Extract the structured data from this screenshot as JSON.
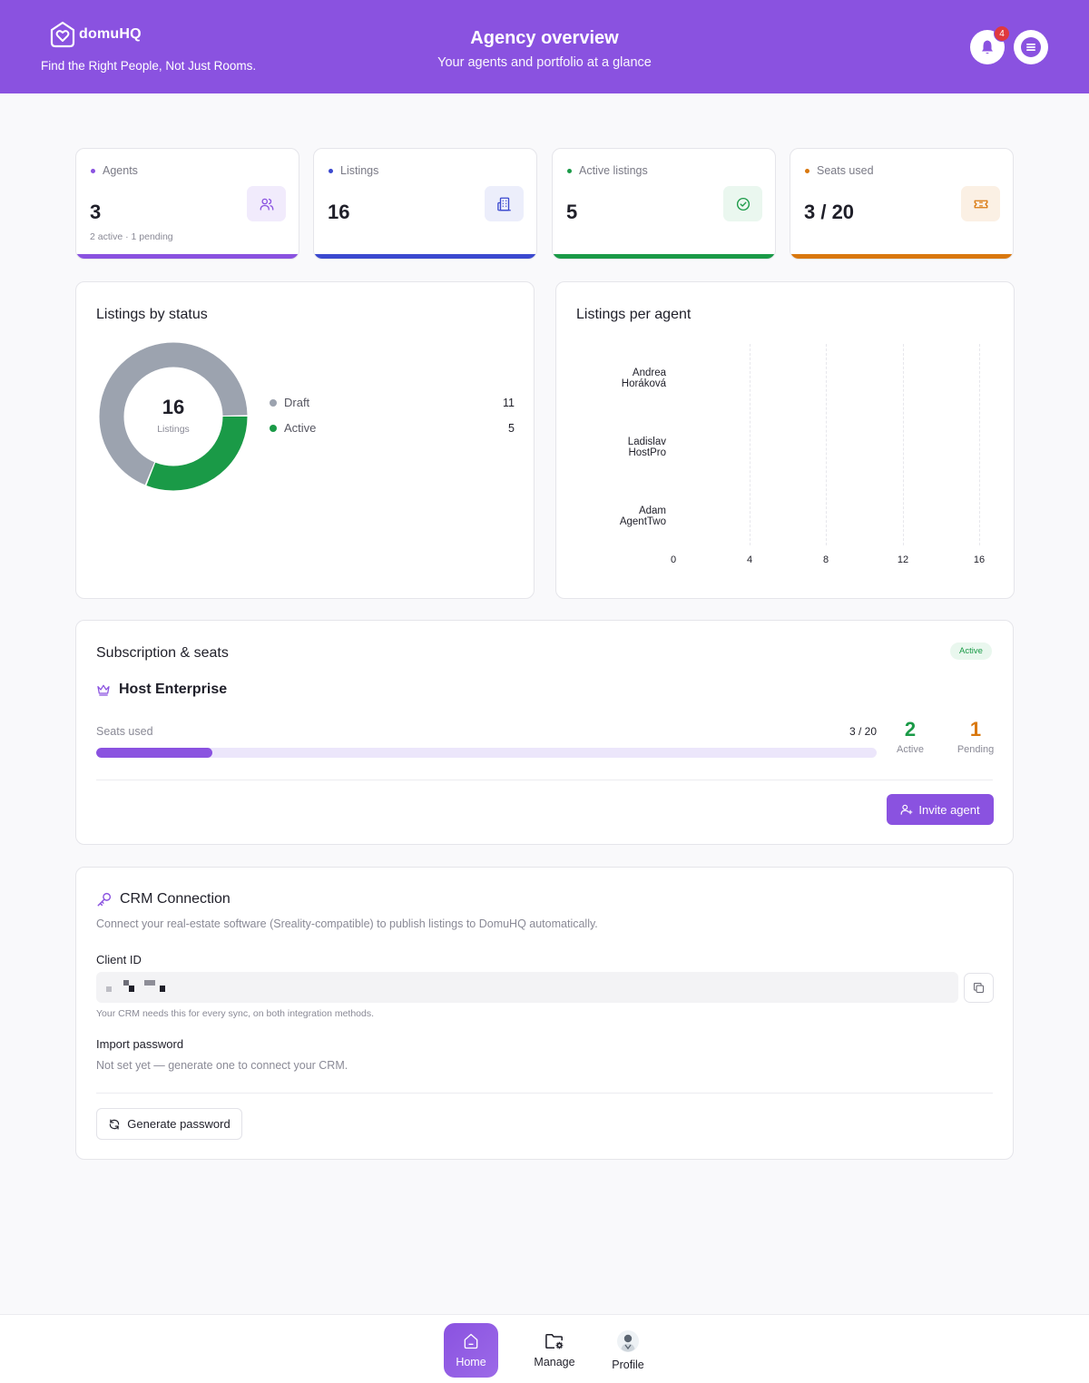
{
  "brand": {
    "name": "domuHQ",
    "tagline": "Find the Right People, Not Just Rooms."
  },
  "header": {
    "title": "Agency overview",
    "subtitle": "Your agents and portfolio at a glance",
    "notification_count": "4"
  },
  "stats": [
    {
      "label": "Agents",
      "value": "3",
      "note": "2 active · 1 pending",
      "icon": "users-icon",
      "color": "#8a52e0"
    },
    {
      "label": "Listings",
      "value": "16",
      "note": "",
      "icon": "building-icon",
      "color": "#3b49cf"
    },
    {
      "label": "Active listings",
      "value": "5",
      "note": "",
      "icon": "check-circle-icon",
      "color": "#1a9a47"
    },
    {
      "label": "Seats used",
      "value": "3 / 20",
      "note": "",
      "icon": "ticket-icon",
      "color": "#d9780e"
    }
  ],
  "listings_by_status": {
    "title": "Listings by status",
    "total": "16",
    "total_label": "Listings",
    "legend": [
      {
        "label": "Draft",
        "count": "11",
        "color": "#9ca3af"
      },
      {
        "label": "Active",
        "count": "5",
        "color": "#1a9a47"
      }
    ]
  },
  "listings_per_agent": {
    "title": "Listings per agent",
    "agents": [
      {
        "line1": "Andrea",
        "line2": "Horáková"
      },
      {
        "line1": "Ladislav",
        "line2": "HostPro"
      },
      {
        "line1": "Adam",
        "line2": "AgentTwo"
      }
    ],
    "ticks": [
      "0",
      "4",
      "8",
      "12",
      "16"
    ]
  },
  "chart_data": [
    {
      "type": "pie",
      "title": "Listings by status",
      "categories": [
        "Draft",
        "Active"
      ],
      "values": [
        11,
        5
      ],
      "colors": [
        "#9ca3af",
        "#1a9a47"
      ],
      "center_value": 16,
      "center_label": "Listings",
      "legend_placement": "right"
    },
    {
      "type": "bar",
      "orientation": "horizontal",
      "title": "Listings per agent",
      "categories": [
        "Andrea Horáková",
        "Ladislav HostPro",
        "Adam AgentTwo"
      ],
      "values": [
        0,
        0,
        0
      ],
      "xlim": [
        0,
        16
      ],
      "xticks": [
        0,
        4,
        8,
        12,
        16
      ],
      "grid": true
    }
  ],
  "subscription": {
    "title": "Subscription & seats",
    "status": "Active",
    "plan": "Host Enterprise",
    "seats_label": "Seats used",
    "seats_text": "3 / 20",
    "seats_used": 3,
    "seats_total": 20,
    "active_count": "2",
    "active_label": "Active",
    "pending_count": "1",
    "pending_label": "Pending",
    "invite_label": "Invite agent"
  },
  "crm": {
    "title": "CRM Connection",
    "description": "Connect your real-estate software (Sreality-compatible) to publish listings to DomuHQ automatically.",
    "client_id_label": "Client ID",
    "client_id_help": "Your CRM needs this for every sync, on both integration methods.",
    "import_password_label": "Import password",
    "import_password_status": "Not set yet — generate one to connect your CRM.",
    "generate_label": "Generate password"
  },
  "nav": [
    {
      "label": "Home",
      "icon": "home-icon"
    },
    {
      "label": "Manage",
      "icon": "folder-gear-icon"
    },
    {
      "label": "Profile",
      "icon": "avatar-icon"
    }
  ]
}
